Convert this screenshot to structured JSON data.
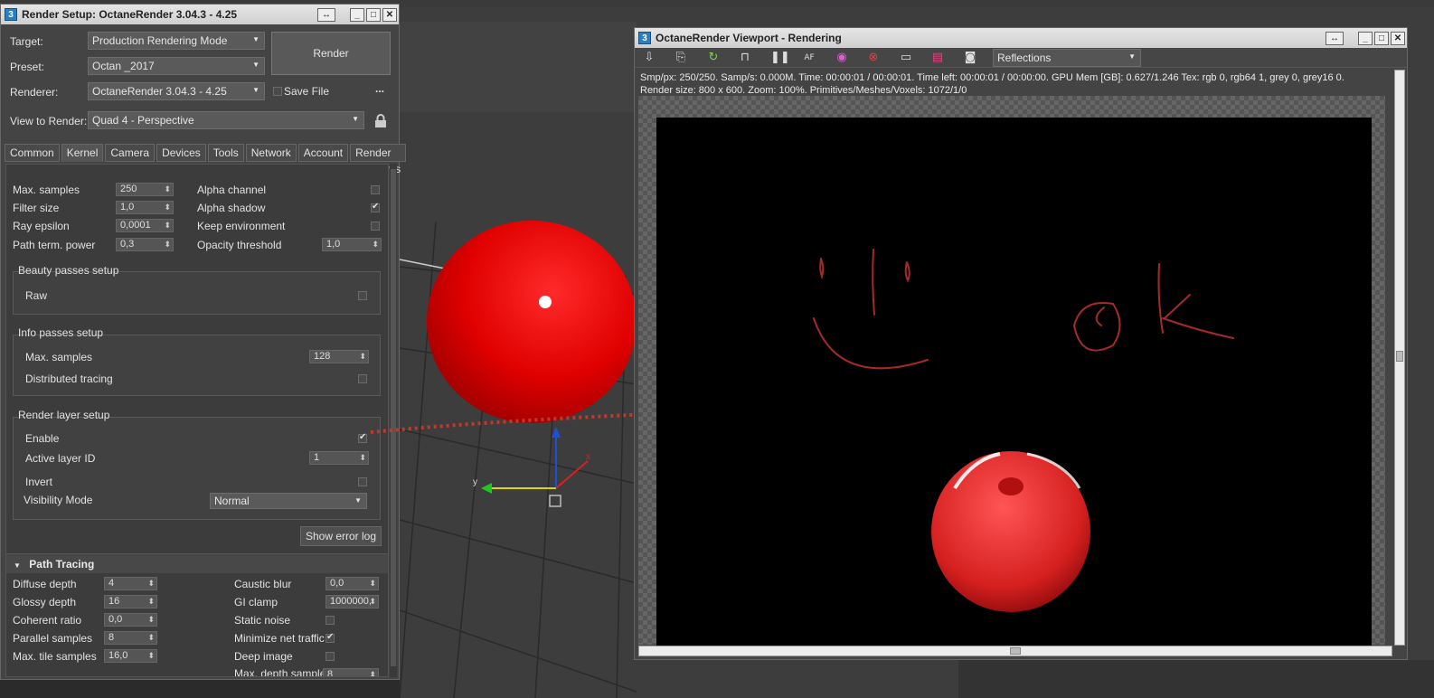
{
  "setup_window": {
    "title": "Render Setup: OctaneRender 3.04.3 - 4.25",
    "badge": "3",
    "target_label": "Target:",
    "target_value": "Production Rendering Mode",
    "preset_label": "Preset:",
    "preset_value": "Octan _2017",
    "renderer_label": "Renderer:",
    "renderer_value": "OctaneRender 3.04.3 - 4.25",
    "save_file_label": "Save File",
    "more_label": "...",
    "render_button": "Render",
    "view_label": "View to Render:",
    "view_value": "Quad 4 - Perspective",
    "tabs": [
      "Common",
      "Kernel",
      "Camera",
      "Devices",
      "Tools",
      "Network",
      "Account",
      "Render Elements"
    ],
    "kernel": {
      "max_samples_label": "Max. samples",
      "max_samples": "250",
      "filter_size_label": "Filter size",
      "filter_size": "1,0",
      "ray_epsilon_label": "Ray epsilon",
      "ray_epsilon": "0,0001",
      "path_term_label": "Path term. power",
      "path_term": "0,3",
      "alpha_channel_label": "Alpha channel",
      "alpha_shadow_label": "Alpha shadow",
      "keep_env_label": "Keep environment",
      "opacity_threshold_label": "Opacity threshold",
      "opacity_threshold": "1,0"
    },
    "beauty": {
      "title": "Beauty passes setup",
      "raw_label": "Raw"
    },
    "info": {
      "title": "Info passes setup",
      "max_samples_label": "Max. samples",
      "max_samples": "128",
      "distributed_label": "Distributed tracing"
    },
    "layer": {
      "title": "Render layer setup",
      "enable_label": "Enable",
      "active_layer_label": "Active layer ID",
      "active_layer": "1",
      "invert_label": "Invert",
      "visibility_label": "Visibility Mode",
      "visibility_value": "Normal"
    },
    "show_error_log": "Show error log",
    "path_tracing": {
      "title": "Path Tracing",
      "diffuse_label": "Diffuse depth",
      "diffuse": "4",
      "glossy_label": "Glossy depth",
      "glossy": "16",
      "coherent_label": "Coherent ratio",
      "coherent": "0,0",
      "parallel_label": "Parallel samples",
      "parallel": "8",
      "tile_label": "Max. tile samples",
      "tile": "16,0",
      "caustic_label": "Caustic blur",
      "caustic": "0,0",
      "gi_label": "GI clamp",
      "gi": "1000000,",
      "static_noise_label": "Static noise",
      "min_net_label": "Minimize net traffic",
      "deep_image_label": "Deep image",
      "max_depth_label": "Max. depth samples",
      "max_depth": "8"
    }
  },
  "octane_window": {
    "title": "OctaneRender Viewport - Rendering",
    "badge": "3",
    "mode_value": "Reflections",
    "status_line1": "Smp/px: 250/250.   Samp/s: 0.000M.   Time: 00:00:01 / 00:00:01.   Time left: 00:00:01 / 00:00:00.   GPU Mem [GB]: 0.627/1.246   Tex: rgb 0, rgb64 1, grey 0, grey16 0.",
    "status_line2": "Render size: 800 x 600.   Zoom: 100%.   Primitives/Meshes/Voxels: 1072/1/0"
  },
  "colors": {
    "sphere_red": "#e00000",
    "annotation_red": "#c0392b"
  }
}
